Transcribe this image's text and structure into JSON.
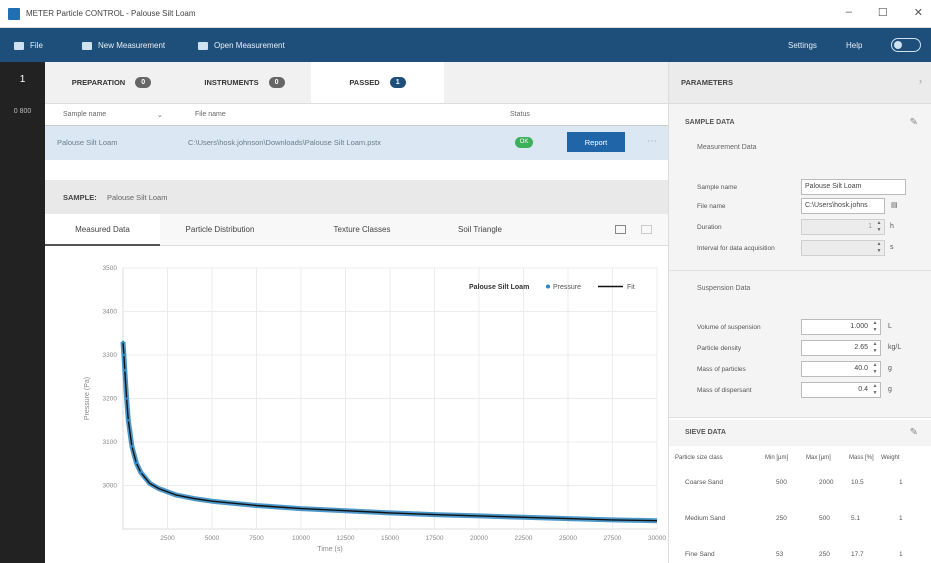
{
  "window": {
    "title": "METER Particle CONTROL - Palouse Silt Loam",
    "controls": [
      "–",
      "☐",
      "✕"
    ]
  },
  "menubar": {
    "file": "File",
    "new_measurement": "New Measurement",
    "open_measurement": "Open Measurement",
    "settings": "Settings",
    "help": "Help"
  },
  "rail": {
    "item1": "1",
    "item2": "0 800"
  },
  "tabs": [
    {
      "label": "PREPARATION",
      "count": "0"
    },
    {
      "label": "INSTRUMENTS",
      "count": "0"
    },
    {
      "label": "PASSED",
      "count": "1"
    }
  ],
  "columns": {
    "sample_name": "Sample name",
    "file_name": "File name",
    "status": "Status"
  },
  "passed_row": {
    "sample_name": "Palouse Silt Loam",
    "file_name": "C:\\Users\\hosk.johnson\\Downloads\\Palouse Silt Loam.pstx",
    "status": "OK",
    "report_button": "Report",
    "more": "⋯"
  },
  "sample_bar": {
    "label": "SAMPLE:",
    "name": "Palouse Silt Loam"
  },
  "view_tabs": [
    "Measured Data",
    "Particle Distribution",
    "Texture Classes",
    "Soil Triangle"
  ],
  "chart_data": {
    "type": "line",
    "title": "Palouse Silt Loam",
    "legend": [
      "Pressure",
      "Fit"
    ],
    "legend_position": "top-right",
    "xlabel": "Time (s)",
    "ylabel": "Pressure (Pa)",
    "xlim": [
      0,
      30000
    ],
    "ylim": [
      2900,
      3500
    ],
    "x_ticks": [
      2500,
      5000,
      7500,
      10000,
      12500,
      15000,
      17500,
      20000,
      22500,
      25000,
      27500,
      30000
    ],
    "y_ticks": [
      3000,
      3100,
      3200,
      3300,
      3400,
      3500
    ],
    "grid": true,
    "series": [
      {
        "name": "Pressure",
        "color": "#2e86c1",
        "x": [
          0,
          50,
          100,
          200,
          300,
          500,
          750,
          1000,
          1500,
          2000,
          3000,
          4000,
          5000,
          7500,
          10000,
          12500,
          15000,
          17500,
          20000,
          22500,
          25000,
          27500,
          30000
        ],
        "y": [
          3330,
          3300,
          3265,
          3200,
          3150,
          3090,
          3052,
          3030,
          3005,
          2993,
          2978,
          2970,
          2964,
          2954,
          2947,
          2942,
          2937,
          2933,
          2930,
          2927,
          2924,
          2921,
          2919
        ]
      },
      {
        "name": "Fit",
        "color": "#111111",
        "x": [
          0,
          50,
          100,
          200,
          300,
          500,
          750,
          1000,
          1500,
          2000,
          3000,
          4000,
          5000,
          7500,
          10000,
          12500,
          15000,
          17500,
          20000,
          22500,
          25000,
          27500,
          30000
        ],
        "y": [
          3330,
          3300,
          3265,
          3200,
          3150,
          3090,
          3052,
          3030,
          3005,
          2993,
          2978,
          2970,
          2964,
          2954,
          2947,
          2942,
          2937,
          2933,
          2930,
          2927,
          2924,
          2921,
          2919
        ]
      }
    ]
  },
  "parameters": {
    "header": "PARAMETERS",
    "sample_data": {
      "title": "SAMPLE DATA",
      "subtitle": "Measurement Data",
      "fields": [
        {
          "label": "Sample name",
          "value": "Palouse Silt Loam"
        },
        {
          "label": "File name",
          "value": "C:\\Users\\hosk.johns"
        },
        {
          "label": "Duration",
          "value": "1",
          "unit": "h"
        },
        {
          "label": "Interval for data acquisition",
          "value": "",
          "unit": "s"
        }
      ]
    },
    "suspension": {
      "title": "Suspension Data",
      "fields": [
        {
          "label": "Volume of suspension",
          "value": "1.000",
          "unit": "L"
        },
        {
          "label": "Particle density",
          "value": "2.65",
          "unit": "kg/L"
        },
        {
          "label": "Mass of particles",
          "value": "40.0",
          "unit": "g"
        },
        {
          "label": "Mass of dispersant",
          "value": "0.4",
          "unit": "g"
        }
      ]
    },
    "sieve_data": {
      "title": "SIEVE DATA",
      "headers": [
        "Particle size class",
        "Min [µm]",
        "Max [µm]",
        "Mass [%]",
        "Weight"
      ],
      "rows": [
        {
          "class": "Coarse Sand",
          "min": "500",
          "max": "2000",
          "mass": "10.5",
          "weight": "1"
        },
        {
          "class": "Medium Sand",
          "min": "250",
          "max": "500",
          "mass": "5.1",
          "weight": "1"
        },
        {
          "class": "Fine Sand",
          "min": "53",
          "max": "250",
          "mass": "17.7",
          "weight": "1"
        }
      ]
    }
  }
}
